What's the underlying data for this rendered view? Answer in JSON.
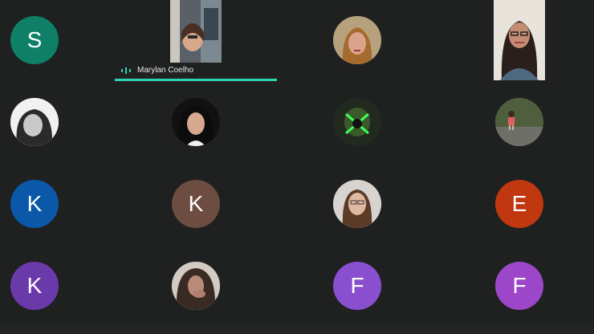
{
  "active_speaker": {
    "name": "Marylan Coelho"
  },
  "colors": {
    "background": "#1f2020",
    "speaking_bar": "#2bd4b4"
  },
  "participants": [
    {
      "initial": "S",
      "color": "#0f8068"
    },
    {
      "video": "Marylan Coelho"
    },
    {
      "photo": "woman-blonde-hair"
    },
    {
      "video": "woman-glasses"
    },
    {
      "photo": "woman-dark-hair"
    },
    {
      "photo": "woman-curly-hair"
    },
    {
      "photo": "person-green-mask"
    },
    {
      "photo": "child-walking"
    },
    {
      "initial": "K",
      "color": "#0b57a8"
    },
    {
      "initial": "K",
      "color": "#6d4c41"
    },
    {
      "photo": "woman-long-hair"
    },
    {
      "initial": "E",
      "color": "#c1370f"
    },
    {
      "initial": "K",
      "color": "#6a3aaa"
    },
    {
      "photo": "woman-hand-face"
    },
    {
      "initial": "F",
      "color": "#8a4fcf"
    },
    {
      "initial": "F",
      "color": "#9c46c9"
    }
  ]
}
